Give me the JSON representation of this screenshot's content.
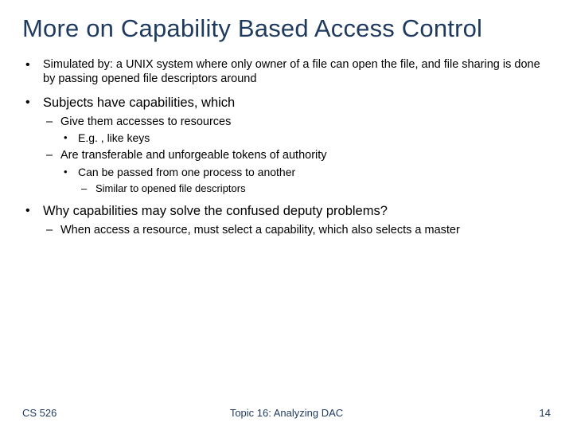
{
  "title": "More on Capability Based Access Control",
  "bullets": {
    "b1": "Simulated by: a UNIX system where only owner of a file can open the file, and file sharing is done by passing opened file descriptors around",
    "b2": "Subjects have capabilities, which",
    "b2_1": "Give them accesses to resources",
    "b2_1_1": "E.g. , like keys",
    "b2_2": "Are transferable and unforgeable tokens of authority",
    "b2_2_1": "Can be passed from one process to another",
    "b2_2_1_1": "Similar to opened file descriptors",
    "b3": "Why capabilities may solve the confused deputy problems?",
    "b3_1": "When access a resource, must select a capability, which also selects a master"
  },
  "footer": {
    "left": "CS 526",
    "center": "Topic 16: Analyzing DAC",
    "right": "14"
  }
}
